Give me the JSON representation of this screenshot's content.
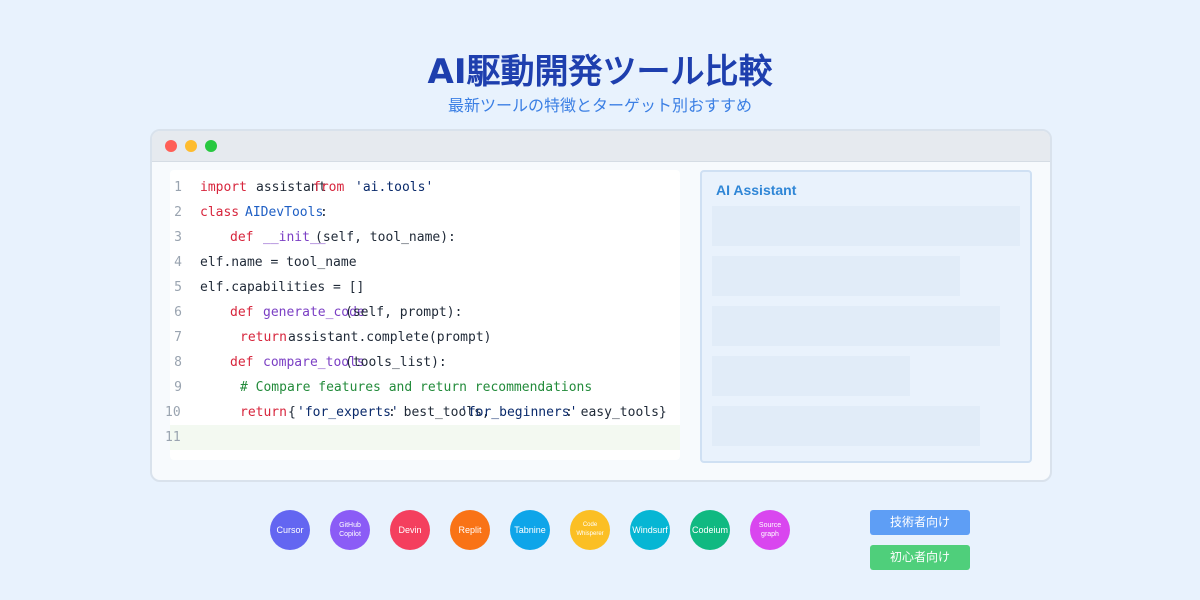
{
  "header": {
    "title": "AI駆動開発ツール比較",
    "subtitle": "最新ツールの特徴とターゲット別おすすめ"
  },
  "editor": {
    "line_numbers": [
      "1",
      "2",
      "3",
      "4",
      "5",
      "6",
      "7",
      "8",
      "9",
      "10",
      "11"
    ],
    "lines": [
      [
        {
          "t": "import",
          "c": "kw"
        },
        {
          "t": "assistant",
          "c": "txt"
        },
        {
          "t": "from",
          "c": "kw"
        },
        {
          "t": "'ai.tools'",
          "c": "str"
        }
      ],
      [
        {
          "t": "class",
          "c": "kw"
        },
        {
          "t": "AIDevTools",
          "c": "cls"
        },
        {
          "t": ":",
          "c": "txt"
        }
      ],
      [
        {
          "t": "def",
          "c": "kw"
        },
        {
          "t": "__init__",
          "c": "fn"
        },
        {
          "t": "(self, tool_name):",
          "c": "txt"
        }
      ],
      [
        {
          "t": "elf.name = tool_name",
          "c": "txt"
        }
      ],
      [
        {
          "t": "elf.capabilities = []",
          "c": "txt"
        }
      ],
      [
        {
          "t": "def",
          "c": "kw"
        },
        {
          "t": "generate_code",
          "c": "fn"
        },
        {
          "t": "(self, prompt):",
          "c": "txt"
        }
      ],
      [
        {
          "t": "return",
          "c": "kw"
        },
        {
          "t": "assistant.complete(prompt)",
          "c": "txt"
        }
      ],
      [
        {
          "t": "def",
          "c": "kw"
        },
        {
          "t": "compare_tools",
          "c": "fn"
        },
        {
          "t": "(tools_list):",
          "c": "txt"
        }
      ],
      [
        {
          "t": "# Compare features and return recommendations",
          "c": "cmt"
        }
      ],
      [
        {
          "t": "return",
          "c": "kw"
        },
        {
          "t": "{",
          "c": "txt"
        },
        {
          "t": "'for_experts'",
          "c": "str"
        },
        {
          "t": ": best_tools,",
          "c": "txt"
        },
        {
          "t": "'for_beginners'",
          "c": "str"
        },
        {
          "t": ": easy_tools}",
          "c": "txt"
        }
      ],
      []
    ]
  },
  "assistant": {
    "title": "AI Assistant"
  },
  "tools": [
    {
      "label": "Cursor",
      "color": "#6366f1"
    },
    {
      "label": "GitHub\nCopilot",
      "color": "#8b5cf6"
    },
    {
      "label": "Devin",
      "color": "#f43f5e"
    },
    {
      "label": "Replit",
      "color": "#f97316"
    },
    {
      "label": "Tabnine",
      "color": "#0ea5e9"
    },
    {
      "label": "Code\nWhisperer",
      "color": "#fbbf24"
    },
    {
      "label": "Windsurf",
      "color": "#06b6d4"
    },
    {
      "label": "Codeium",
      "color": "#10b981"
    },
    {
      "label": "Source\ngraph",
      "color": "#d946ef"
    }
  ],
  "tags": {
    "experts": "技術者向け",
    "beginners": "初心者向け",
    "experts_color": "#5e9ef5",
    "beginners_color": "#4fcf7b"
  },
  "colors": {
    "title": "#1e3fae",
    "subtitle": "#3b7fe4",
    "background": "#e8f2fd"
  }
}
